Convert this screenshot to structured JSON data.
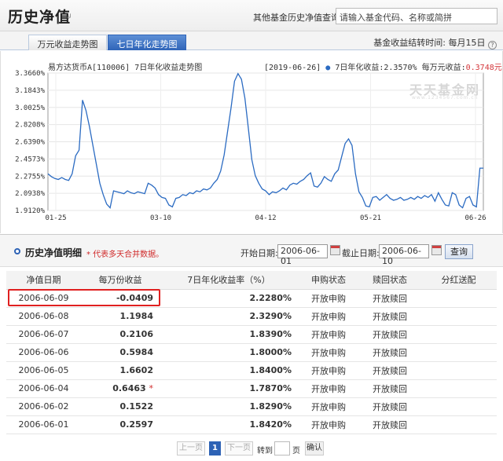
{
  "header": {
    "title": "历史净值",
    "query_label": "其他基金历史净值查询:",
    "search_placeholder": "请输入基金代码、名称或简拼"
  },
  "tabs": [
    {
      "label": "万元收益走势图",
      "active": false
    },
    {
      "label": "七日年化走势图",
      "active": true
    }
  ],
  "settlement": "基金收益结转时间: 每月15日",
  "chart": {
    "title": "易方达货币A[110006] 7日年化收益走势图",
    "legend_date": "[2019-06-26]",
    "legend_series_label": "7日年化收益:",
    "legend_series_value": "2.3570%",
    "legend_wan_label": "每万元收益:",
    "legend_wan_value": "0.3748元",
    "watermark": "天天基金网",
    "watermark_sub": "www.1234567.com.cn",
    "line_color": "#2b6bc2"
  },
  "chart_data": {
    "type": "line",
    "title": "易方达货币A[110006] 7日年化收益走势图",
    "xlabel": "",
    "ylabel": "",
    "x_ticks": [
      "01-25",
      "03-10",
      "04-12",
      "05-21",
      "06-26"
    ],
    "y_ticks": [
      "3.3660%",
      "3.1843%",
      "3.0025%",
      "2.8208%",
      "2.6390%",
      "2.4573%",
      "2.2755%",
      "2.0938%",
      "1.9120%"
    ],
    "ylim": [
      1.912,
      3.366
    ],
    "grid": true,
    "series": [
      {
        "name": "7日年化收益",
        "values": [
          2.3,
          2.27,
          2.25,
          2.24,
          2.26,
          2.24,
          2.23,
          2.3,
          2.49,
          2.55,
          3.08,
          2.97,
          2.8,
          2.6,
          2.4,
          2.2,
          2.08,
          1.98,
          1.94,
          2.12,
          2.11,
          2.1,
          2.09,
          2.12,
          2.1,
          2.09,
          2.11,
          2.1,
          2.09,
          2.2,
          2.18,
          2.15,
          2.08,
          2.05,
          2.04,
          1.97,
          1.95,
          2.04,
          2.05,
          2.08,
          2.07,
          2.1,
          2.09,
          2.12,
          2.11,
          2.14,
          2.13,
          2.15,
          2.2,
          2.24,
          2.33,
          2.5,
          2.75,
          3.0,
          3.28,
          3.36,
          3.3,
          3.1,
          2.78,
          2.45,
          2.28,
          2.2,
          2.14,
          2.12,
          2.08,
          2.11,
          2.1,
          2.12,
          2.15,
          2.13,
          2.18,
          2.2,
          2.19,
          2.22,
          2.24,
          2.28,
          2.31,
          2.17,
          2.16,
          2.2,
          2.27,
          2.24,
          2.22,
          2.3,
          2.34,
          2.48,
          2.62,
          2.67,
          2.6,
          2.3,
          2.11,
          2.05,
          1.96,
          1.95,
          2.05,
          2.06,
          2.02,
          2.05,
          2.08,
          2.04,
          2.02,
          2.03,
          2.05,
          2.02,
          2.03,
          2.05,
          2.03,
          2.06,
          2.04,
          2.07,
          2.05,
          2.08,
          2.01,
          2.1,
          2.03,
          1.97,
          1.96,
          2.1,
          2.08,
          1.97,
          1.94,
          2.04,
          2.06,
          1.97,
          1.95,
          2.36,
          2.36
        ]
      }
    ]
  },
  "detail": {
    "title": "历史净值明细",
    "note": "* 代表多天合并数据。",
    "start_label": "开始日期:",
    "start_value": "2006-06-01",
    "end_label": "截止日期:",
    "end_value": "2006-06-10",
    "query_button": "查询"
  },
  "table": {
    "headers": [
      "净值日期",
      "每万份收益",
      "7日年化收益率（%）",
      "申购状态",
      "赎回状态",
      "分红送配"
    ],
    "rows": [
      {
        "date": "2006-06-09",
        "income": "-0.0409",
        "star": "",
        "rate": "2.2280%",
        "buy": "开放申购",
        "redeem": "开放赎回",
        "dividend": ""
      },
      {
        "date": "2006-06-08",
        "income": "1.1984",
        "star": "",
        "rate": "2.3290%",
        "buy": "开放申购",
        "redeem": "开放赎回",
        "dividend": ""
      },
      {
        "date": "2006-06-07",
        "income": "0.2106",
        "star": "",
        "rate": "1.8390%",
        "buy": "开放申购",
        "redeem": "开放赎回",
        "dividend": ""
      },
      {
        "date": "2006-06-06",
        "income": "0.5984",
        "star": "",
        "rate": "1.8000%",
        "buy": "开放申购",
        "redeem": "开放赎回",
        "dividend": ""
      },
      {
        "date": "2006-06-05",
        "income": "1.6602",
        "star": "",
        "rate": "1.8400%",
        "buy": "开放申购",
        "redeem": "开放赎回",
        "dividend": ""
      },
      {
        "date": "2006-06-04",
        "income": "0.6463",
        "star": "*",
        "rate": "1.7870%",
        "buy": "开放申购",
        "redeem": "开放赎回",
        "dividend": ""
      },
      {
        "date": "2006-06-02",
        "income": "0.1522",
        "star": "",
        "rate": "1.8290%",
        "buy": "开放申购",
        "redeem": "开放赎回",
        "dividend": ""
      },
      {
        "date": "2006-06-01",
        "income": "0.2597",
        "star": "",
        "rate": "1.8420%",
        "buy": "开放申购",
        "redeem": "开放赎回",
        "dividend": ""
      }
    ]
  },
  "pager": {
    "prev": "上一页",
    "current": "1",
    "next": "下一页",
    "jump_label": "转到",
    "page_label": "页",
    "confirm": "确认"
  }
}
